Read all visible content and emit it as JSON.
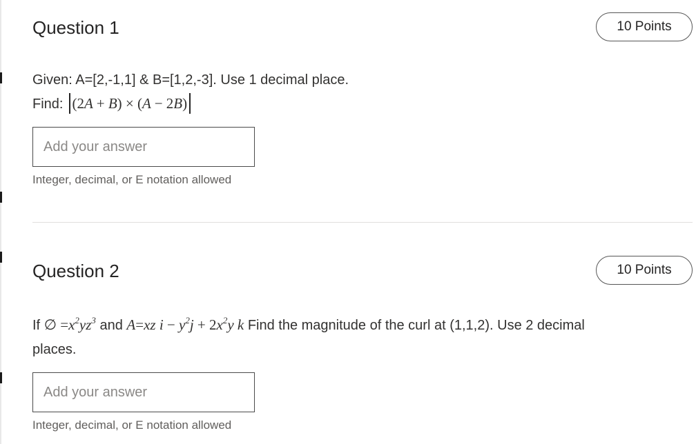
{
  "questions": [
    {
      "title": "Question 1",
      "points": "10 Points",
      "line1": "Given: A=[2,-1,1] & B=[1,2,-3]. Use 1 decimal place.",
      "find_label": "Find:",
      "answer_placeholder": "Add your answer",
      "hint": "Integer, decimal, or E notation allowed"
    },
    {
      "title": "Question 2",
      "points": "10 Points",
      "if_label": "If",
      "and_label": "and",
      "rest_text": "Find the magnitude of the curl at (1,1,2). Use 2 decimal",
      "line2": "places.",
      "answer_placeholder": "Add your answer",
      "hint": "Integer, decimal, or E notation allowed"
    }
  ]
}
